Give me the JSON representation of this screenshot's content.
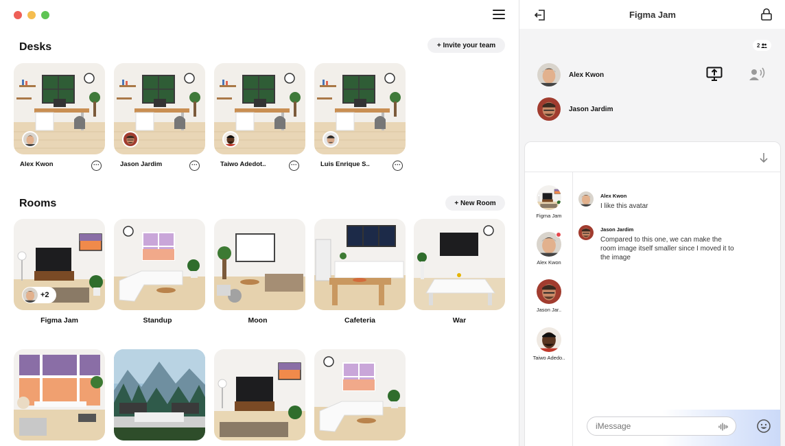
{
  "desks": {
    "title": "Desks",
    "invite_label": "+ Invite your team",
    "items": [
      {
        "name": "Alex Kwon"
      },
      {
        "name": "Jason Jardim"
      },
      {
        "name": "Taiwo Adedot.."
      },
      {
        "name": "Luis Enrique S.."
      }
    ]
  },
  "rooms": {
    "title": "Rooms",
    "new_room_label": "+ New Room",
    "items": [
      {
        "name": "Figma Jam",
        "badge": "+2"
      },
      {
        "name": "Standup"
      },
      {
        "name": "Moon"
      },
      {
        "name": "Cafeteria"
      },
      {
        "name": "War"
      }
    ]
  },
  "panel": {
    "title": "Figma Jam",
    "member_count": "2",
    "members": [
      {
        "name": "Alex Kwon"
      },
      {
        "name": "Jason Jardim"
      }
    ]
  },
  "chat": {
    "rooms": [
      {
        "label": "Figma Jam"
      },
      {
        "label": "Alex Kwon"
      },
      {
        "label": "Jason Jar.."
      },
      {
        "label": "Taiwo Adedo.."
      }
    ],
    "messages": [
      {
        "author": "Alex Kwon",
        "text": "I like this avatar"
      },
      {
        "author": "Jason Jardim",
        "text": "Compared to this one, we can make the room image itself smaller since I moved it to the image"
      }
    ],
    "input_placeholder": "iMessage"
  },
  "colors": {
    "accent_red": "#e5484d",
    "traffic_red": "#ee5f57",
    "traffic_yellow": "#f5bd4f",
    "traffic_green": "#5fc454"
  }
}
